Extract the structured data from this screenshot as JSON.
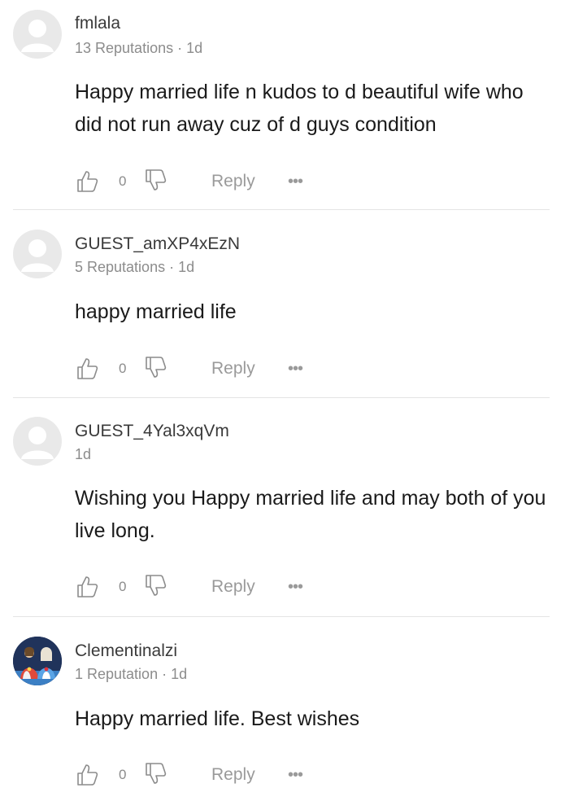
{
  "comments": [
    {
      "username": "fmlala",
      "reputation": "13 Reputations",
      "separator": " · ",
      "time": "1d",
      "text": "Happy married life n kudos to d beautiful wife who did not run away cuz of d guys condition",
      "likes": "0",
      "reply_label": "Reply",
      "more_label": "•••",
      "avatar": "default-avatar"
    },
    {
      "username": "GUEST_amXP4xEzN",
      "reputation": "5 Reputations",
      "separator": " · ",
      "time": "1d",
      "text": "happy married life",
      "likes": "0",
      "reply_label": "Reply",
      "more_label": "•••",
      "avatar": "default-avatar"
    },
    {
      "username": "GUEST_4Yal3xqVm",
      "reputation": "",
      "separator": "",
      "time": "1d",
      "text": "Wishing you Happy married life and may both of you live long.",
      "likes": "0",
      "reply_label": "Reply",
      "more_label": "•••",
      "avatar": "default-avatar"
    },
    {
      "username": "Clementinalzi",
      "reputation": "1 Reputation",
      "separator": " · ",
      "time": "1d",
      "text": "Happy married life. Best wishes",
      "likes": "0",
      "reply_label": "Reply",
      "more_label": "•••",
      "avatar": "religious-image-avatar"
    }
  ],
  "colors": {
    "text": "#1a1a1a",
    "muted": "#8c8c8c",
    "divider": "#e4e4e4",
    "avatar_bg": "#e9e9e9"
  }
}
